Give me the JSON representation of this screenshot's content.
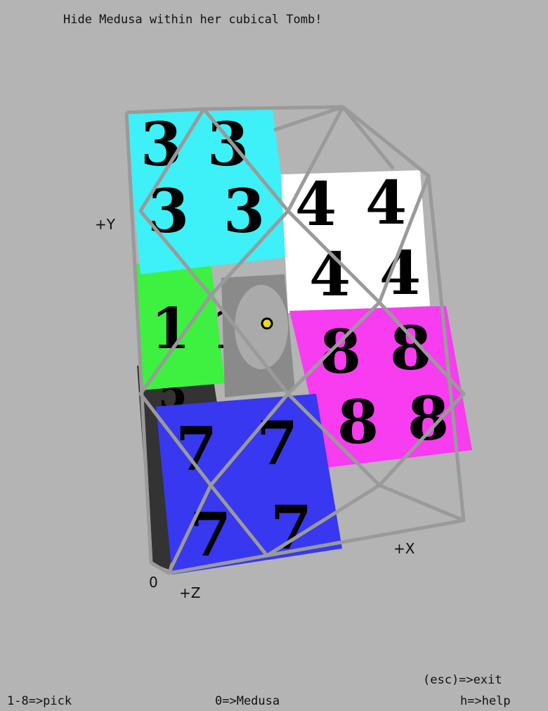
{
  "title": "Hide Medusa within her cubical Tomb!",
  "axes": {
    "y": "+Y",
    "x": "+X",
    "z": "+Z",
    "origin": "0"
  },
  "cubes": [
    {
      "label": "3",
      "color": "#3ef0f8"
    },
    {
      "label": "1",
      "color": "#3ef040"
    },
    {
      "label": "4",
      "color": "#ffffff"
    },
    {
      "label": "8",
      "color": "#f83cf0"
    },
    {
      "label": "7",
      "color": "#3838f0"
    },
    {
      "label": "5",
      "color": "#333333"
    }
  ],
  "medusa_label": "Medusa",
  "hud": {
    "exit": "(esc)=>exit",
    "pick": "1-8=>pick",
    "medusa": "0=>Medusa",
    "help": "h=>help"
  }
}
